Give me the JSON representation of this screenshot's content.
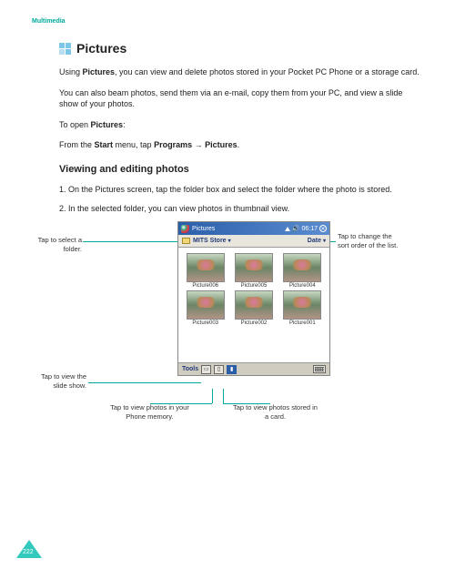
{
  "header": {
    "section": "Multimedia"
  },
  "title": "Pictures",
  "paragraphs": {
    "p1a": "Using ",
    "p1b": "Pictures",
    "p1c": ", you can view and delete photos stored in your Pocket PC Phone or a storage card.",
    "p2": "You can also beam photos, send them via an e-mail, copy them from your PC, and view a slide show of your photos.",
    "p3a": "To open ",
    "p3b": "Pictures",
    "p3c": ":",
    "p4a": "From the ",
    "p4b": "Start",
    "p4c": " menu, tap ",
    "p4d": "Programs",
    "p4e": " → ",
    "p4f": "Pictures",
    "p4g": "."
  },
  "subhead": "Viewing and editing photos",
  "steps": {
    "s1": "1. On the Pictures screen, tap the folder box and select the folder where the photo is stored.",
    "s2": "2. In the selected folder, you can view photos in thumbnail view."
  },
  "device": {
    "app_title": "Pictures",
    "time": "06:17",
    "folder": "MITS Store",
    "sort": "Date",
    "thumbs": [
      "Picture006",
      "Picture005",
      "Picture004",
      "Picture003",
      "Picture002",
      "Picture001"
    ],
    "tools": "Tools"
  },
  "callouts": {
    "c_folder": "Tap to select a folder.",
    "c_sort": "Tap to change the sort order of the list.",
    "c_slide": "Tap to view the slide show.",
    "c_phone": "Tap to view photos in your Phone memory.",
    "c_card": "Tap to view photos stored in a card."
  },
  "page_number": "222"
}
